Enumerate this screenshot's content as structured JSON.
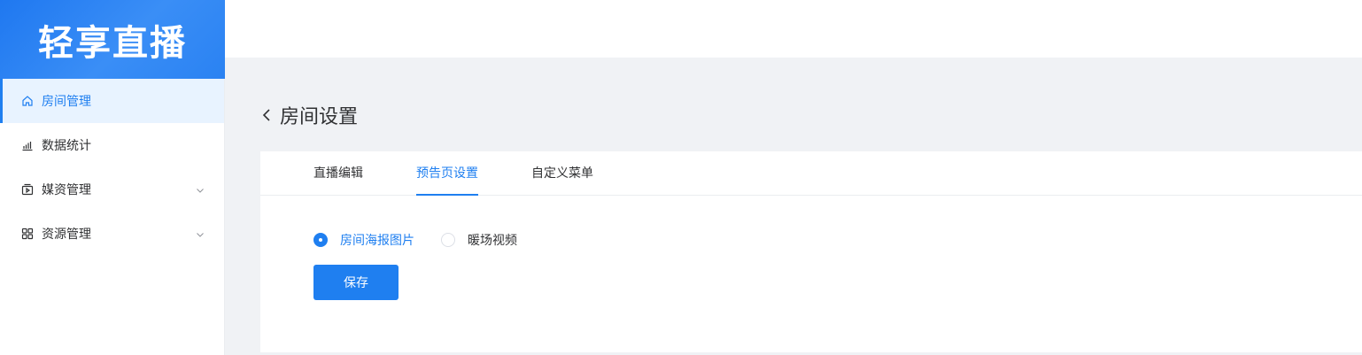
{
  "brand": {
    "title": "轻享直播"
  },
  "sidebar": {
    "items": [
      {
        "label": "房间管理",
        "icon": "home-icon",
        "active": true
      },
      {
        "label": "数据统计",
        "icon": "bar-chart-icon",
        "active": false
      },
      {
        "label": "媒资管理",
        "icon": "media-icon",
        "active": false,
        "expandable": true
      },
      {
        "label": "资源管理",
        "icon": "grid-icon",
        "active": false,
        "expandable": true
      }
    ]
  },
  "page": {
    "title": "房间设置",
    "back_icon": "chevron-left-icon"
  },
  "tabs": [
    {
      "label": "直播编辑",
      "active": false
    },
    {
      "label": "预告页设置",
      "active": true
    },
    {
      "label": "自定义菜单",
      "active": false
    }
  ],
  "form": {
    "options": [
      {
        "label": "房间海报图片",
        "checked": true
      },
      {
        "label": "暖场视频",
        "checked": false
      }
    ],
    "save_label": "保存"
  },
  "colors": {
    "accent": "#1f7ff0",
    "brand_bg": "#2a82f2",
    "page_bg": "#f0f2f5"
  }
}
